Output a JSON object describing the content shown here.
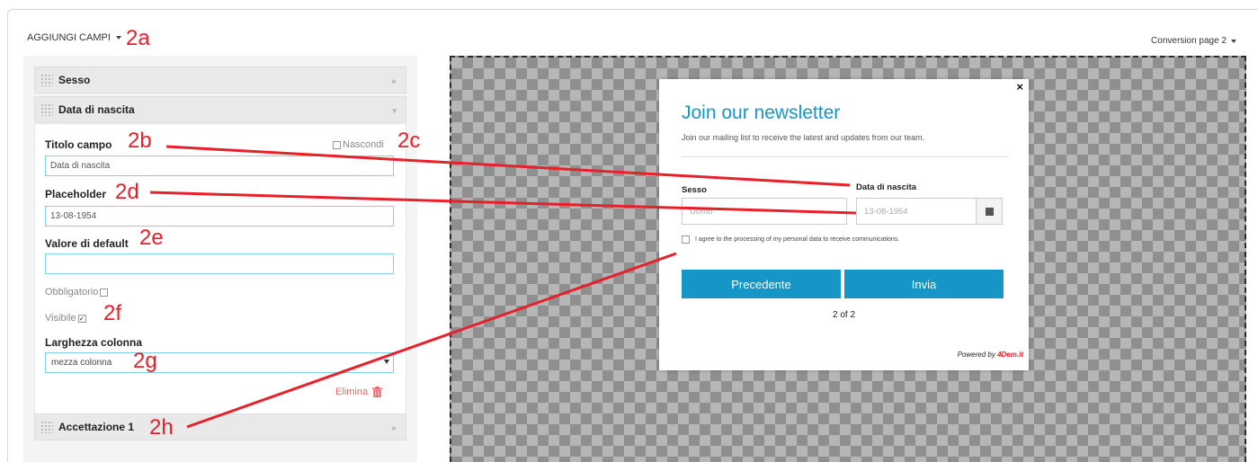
{
  "topbar": {
    "add_fields": "AGGIUNGI CAMPI",
    "conversion_page": "Conversion page 2"
  },
  "annotations": {
    "a": "2a",
    "b": "2b",
    "c": "2c",
    "d": "2d",
    "e": "2e",
    "f": "2f",
    "g": "2g",
    "h": "2h"
  },
  "sidebar": {
    "fields": [
      "Sesso",
      "Data di nascita",
      "Accettazione 1"
    ],
    "field_title_label": "Titolo campo",
    "hide_label": "Nascondi",
    "field_title_value": "Data di nascita",
    "placeholder_label": "Placeholder",
    "placeholder_value": "13-08-1954",
    "default_label": "Valore di default",
    "default_value": "",
    "required_label": "Obbligatorio",
    "visible_label": "Visibile",
    "width_label": "Larghezza colonna",
    "width_value": "mezza colonna",
    "delete_label": "Elimina"
  },
  "popup": {
    "close": "×",
    "title": "Join our newsletter",
    "subtitle": "Join our mailing list to receive the latest and updates from our team.",
    "sex_label": "Sesso",
    "sex_value": "Uomo",
    "dob_label": "Data di nascita",
    "dob_placeholder": "13-08-1954",
    "agree_text": "I agree to the processing of my personal data to receive communications.",
    "prev_button": "Precedente",
    "submit_button": "Invia",
    "pager": "2 of 2",
    "powered_prefix": "Powered by",
    "powered_brand": "4Dem.it"
  },
  "colors": {
    "accent": "#1596c6",
    "annotation": "#e8202a"
  }
}
